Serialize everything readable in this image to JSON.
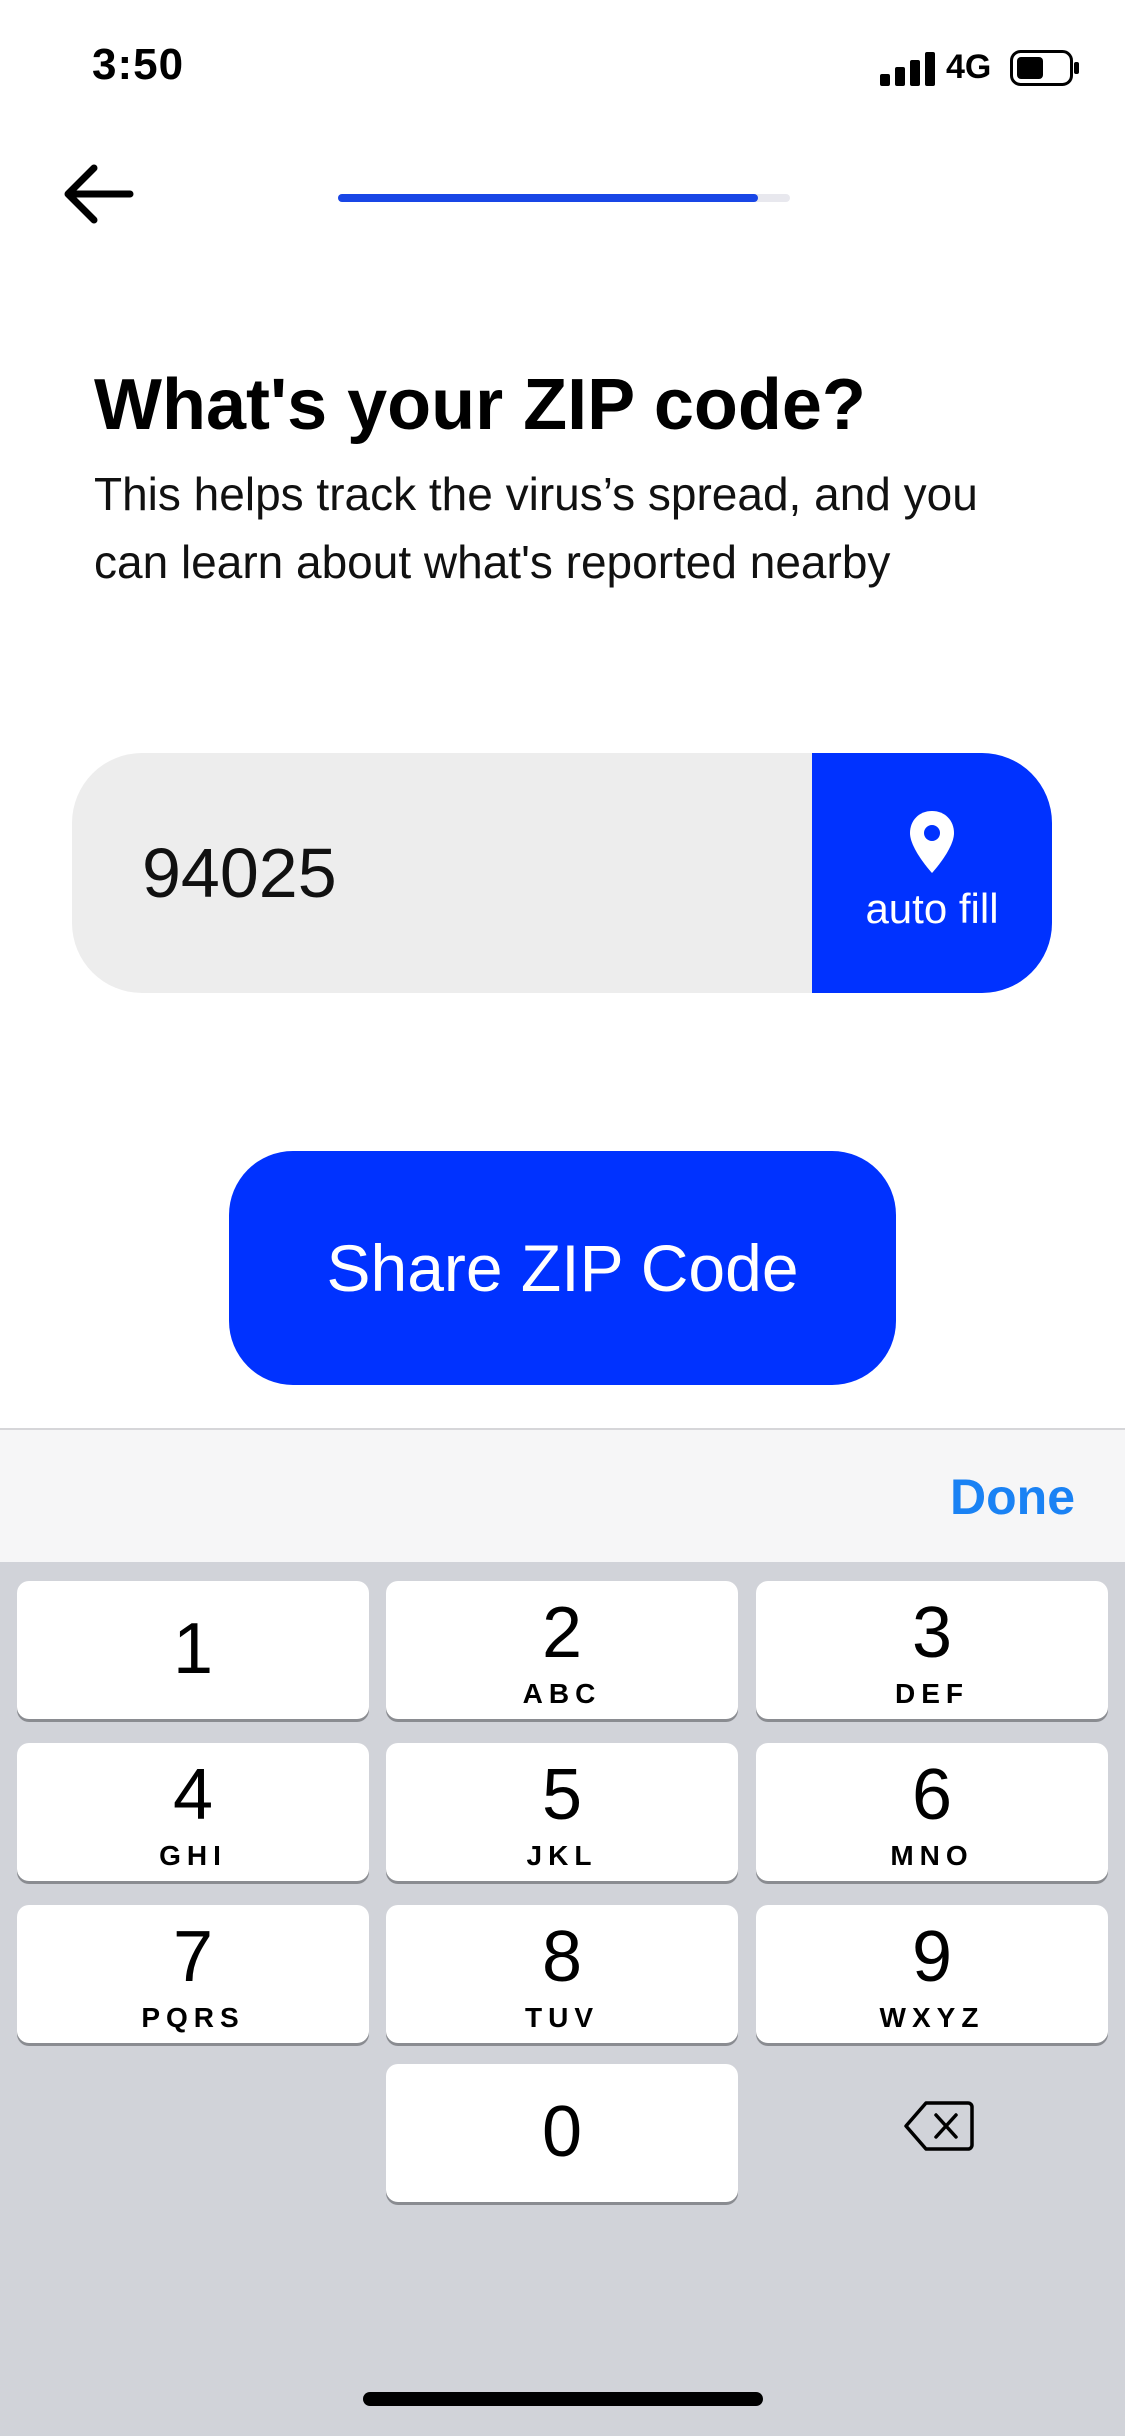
{
  "status_bar": {
    "time": "3:50",
    "network": "4G"
  },
  "onboarding": {
    "progress_fraction": 0.93
  },
  "heading": {
    "title": "What's your ZIP code?",
    "subtitle": "This helps track the virus’s spread, and you can learn about what's reported nearby"
  },
  "zip_field": {
    "value": "94025",
    "autofill_label": "auto fill"
  },
  "share_button": {
    "label": "Share ZIP Code"
  },
  "keyboard_accessory": {
    "done_label": "Done"
  },
  "keypad": {
    "keys": [
      {
        "digit": "1",
        "letters": ""
      },
      {
        "digit": "2",
        "letters": "ABC"
      },
      {
        "digit": "3",
        "letters": "DEF"
      },
      {
        "digit": "4",
        "letters": "GHI"
      },
      {
        "digit": "5",
        "letters": "JKL"
      },
      {
        "digit": "6",
        "letters": "MNO"
      },
      {
        "digit": "7",
        "letters": "PQRS"
      },
      {
        "digit": "8",
        "letters": "TUV"
      },
      {
        "digit": "9",
        "letters": "WXYZ"
      },
      {
        "digit": "0",
        "letters": ""
      }
    ]
  },
  "colors": {
    "accent": "#0032ff",
    "done": "#1a82f4",
    "progress": "#1946e6"
  },
  "icons": [
    "back-arrow-icon",
    "location-pin-icon",
    "delete-backspace-icon",
    "signal-icon",
    "battery-icon"
  ]
}
